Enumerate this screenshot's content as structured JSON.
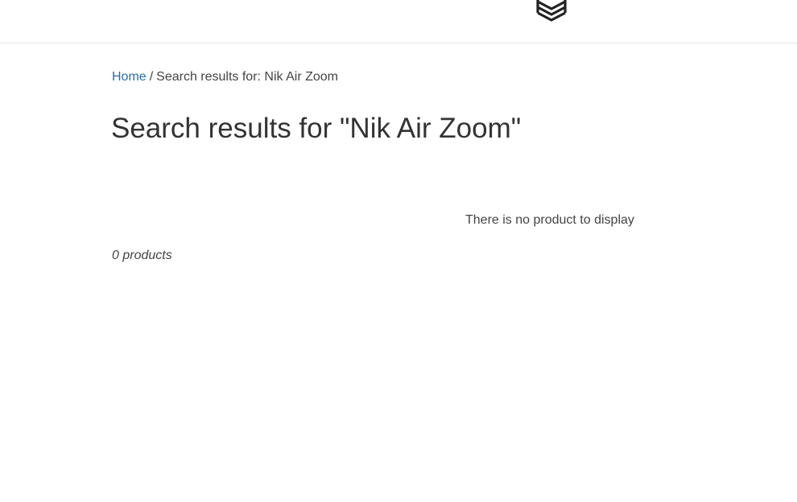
{
  "header": {
    "logo_icon": "stacked-chevrons-logo-icon"
  },
  "breadcrumb": {
    "home_label": "Home",
    "separator": "/",
    "current_label": "Search results for: Nik Air Zoom"
  },
  "main": {
    "title": "Search results for \"Nik Air Zoom\"",
    "empty_message": "There is no product to display",
    "product_count": "0 products"
  },
  "colors": {
    "link": "#2b6cb0",
    "text": "#333333",
    "divider": "#e6e6e6"
  }
}
